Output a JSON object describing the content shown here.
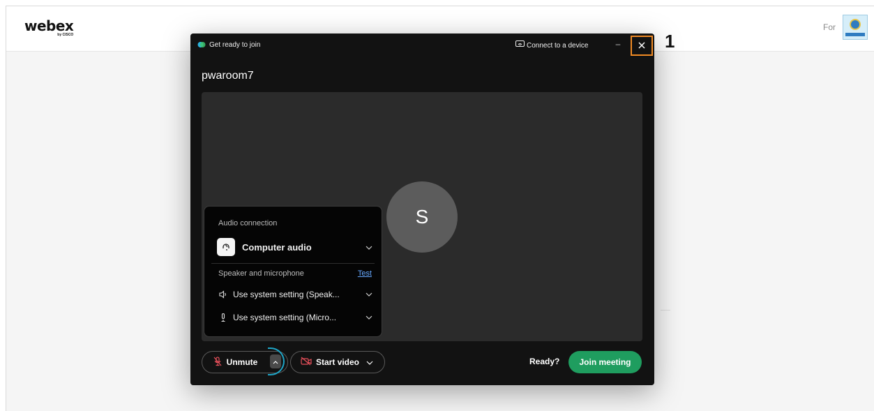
{
  "background_page": {
    "logo_text": "webex",
    "logo_subtext": "by CISCO",
    "header_right_text": "For",
    "org_logo_name": "organization-logo"
  },
  "dialog": {
    "title": "Get ready to join",
    "connect_device_label": "Connect to a device",
    "minimize_symbol": "–",
    "close_symbol": "×",
    "meeting_name": "pwaroom7",
    "avatar_initial": "S"
  },
  "audio_panel": {
    "heading": "Audio connection",
    "audio_option": "Computer audio",
    "speaker_mic_label": "Speaker and microphone",
    "test_link": "Test",
    "speaker_setting": "Use system setting (Speak...",
    "mic_setting": "Use system setting (Micro..."
  },
  "controls": {
    "unmute_label": "Unmute",
    "start_video_label": "Start video",
    "ready_label": "Ready?",
    "join_label": "Join meeting"
  },
  "annotation": {
    "marker": "1"
  },
  "colors": {
    "dialog_bg": "#121212",
    "preview_bg": "#2b2b2b",
    "join_green": "#1f9d5f",
    "highlight_orange": "#f08a24",
    "focus_cyan": "#1ea6c8",
    "link_blue": "#66a8ff",
    "muted_red": "#e8505b"
  },
  "icons": {
    "webex_app": "webex-icon",
    "connect_device": "cast-icon",
    "close": "close-icon",
    "computer_audio": "headset-icon",
    "speaker": "speaker-icon",
    "microphone": "microphone-icon",
    "mute": "microphone-muted-icon",
    "video_off": "camera-off-icon",
    "chevron": "chevron-down-icon"
  }
}
